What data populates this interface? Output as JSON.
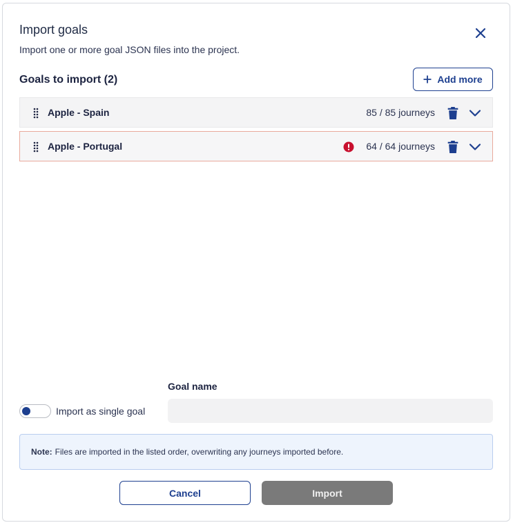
{
  "dialog": {
    "title": "Import goals",
    "subtitle": "Import one or more goal JSON files into the project."
  },
  "goals_section": {
    "title": "Goals to import (2)",
    "add_more_label": "Add more",
    "rows": [
      {
        "name": "Apple - Spain",
        "journeys": "85 / 85 journeys",
        "has_error": false
      },
      {
        "name": "Apple - Portugal",
        "journeys": "64 / 64 journeys",
        "has_error": true
      }
    ]
  },
  "options": {
    "toggle_label": "Import as single goal",
    "toggle_on": false,
    "goal_name_label": "Goal name",
    "goal_name_value": "",
    "goal_name_placeholder": ""
  },
  "note": {
    "prefix": "Note:",
    "text": "Files are imported in the listed order, overwriting any journeys imported before."
  },
  "footer": {
    "cancel_label": "Cancel",
    "import_label": "Import"
  },
  "colors": {
    "primary": "#1d3f8f",
    "error": "#c8102e",
    "disabled": "#7a7a7a",
    "note_bg": "#eef4fd"
  }
}
